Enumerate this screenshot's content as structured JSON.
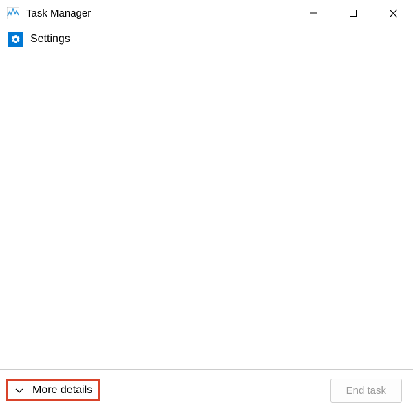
{
  "window": {
    "title": "Task Manager"
  },
  "processes": [
    {
      "name": "Settings",
      "icon": "settings-gear-icon"
    }
  ],
  "footer": {
    "more_details_label": "More details",
    "end_task_label": "End task"
  }
}
